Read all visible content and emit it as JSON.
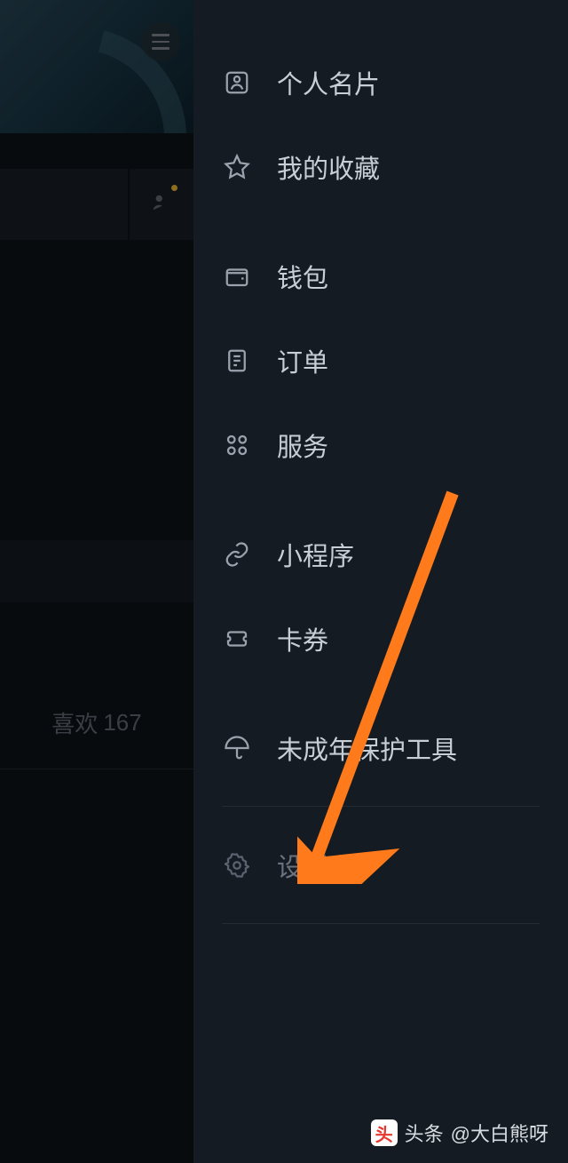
{
  "left": {
    "likes_label": "喜欢",
    "likes_count": "167"
  },
  "menu": {
    "profile": "个人名片",
    "favorites": "我的收藏",
    "wallet": "钱包",
    "orders": "订单",
    "services": "服务",
    "mini_programs": "小程序",
    "coupons": "卡券",
    "minor_protection": "未成年保护工具",
    "settings": "设置"
  },
  "attribution": {
    "source": "头条",
    "author": "@大白熊呀"
  }
}
